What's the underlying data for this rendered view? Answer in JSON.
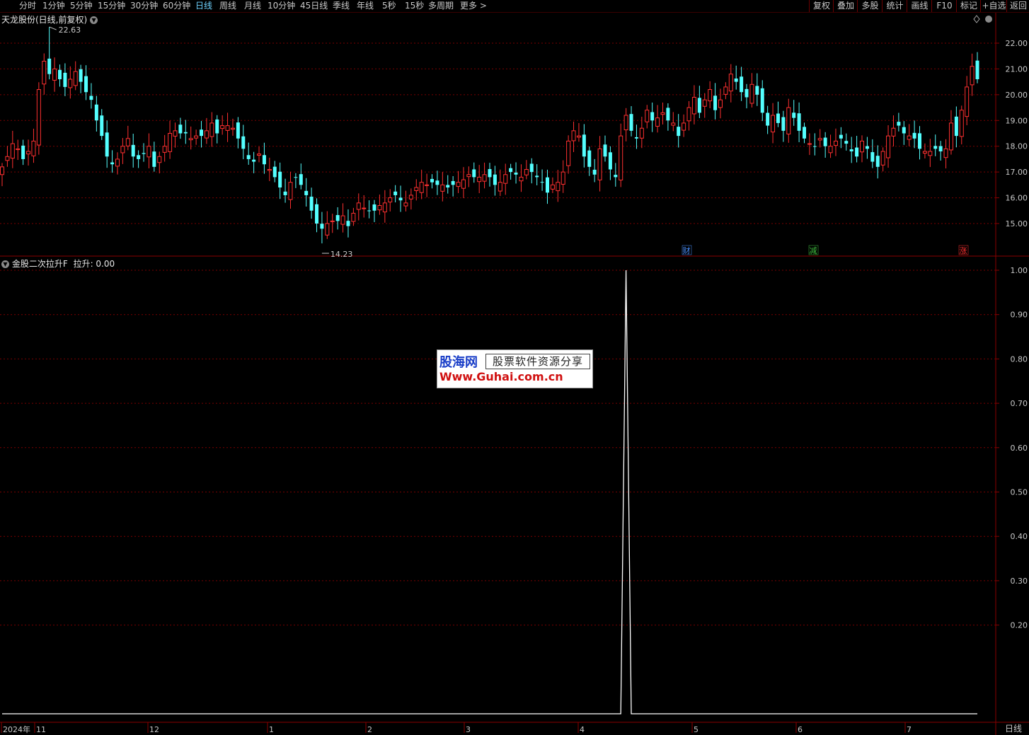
{
  "toolbar": {
    "tabs": [
      "分时",
      "1分钟",
      "5分钟",
      "15分钟",
      "30分钟",
      "60分钟",
      "日线",
      "周线",
      "月线",
      "10分钟",
      "45日线",
      "季线",
      "年线",
      "5秒",
      "15秒",
      "多周期",
      "更多 >"
    ],
    "active_tab": "日线",
    "right_buttons": [
      "复权",
      "叠加",
      "多股",
      "统计",
      "画线",
      "F10",
      "标记",
      "+自选",
      "返回"
    ]
  },
  "upper_panel": {
    "title": "天龙股份(日线,前复权)",
    "high_marker": "22.63",
    "low_marker": "14.23",
    "price_ticks": [
      "22.00",
      "21.00",
      "20.00",
      "19.00",
      "18.00",
      "17.00",
      "16.00",
      "15.00"
    ],
    "event_markers": [
      {
        "label": "财",
        "color": "#4a90ff"
      },
      {
        "label": "减",
        "color": "#40c040"
      },
      {
        "label": "涨",
        "color": "#ff3030"
      }
    ],
    "icons": [
      "diamond-icon",
      "collapse-icon"
    ]
  },
  "lower_panel": {
    "title": "金股二次拉升F",
    "indicator_label": "拉升: 0.00",
    "value_ticks": [
      "1.00",
      "0.90",
      "0.80",
      "0.70",
      "0.60",
      "0.50",
      "0.40",
      "0.30",
      "0.20"
    ]
  },
  "date_axis": {
    "labels": [
      "2024年",
      "11",
      "12",
      "1",
      "2",
      "3",
      "4",
      "5",
      "6",
      "7"
    ]
  },
  "bottom_right_label": "日线",
  "watermark": {
    "brand": "股海网",
    "tagline": "股票软件资源分享",
    "url": "Www.Guhai.com.cn"
  },
  "colors": {
    "up": "#ff3030",
    "down": "#54ffff",
    "grid": "#7a0000",
    "active_tab": "#6fd3ff",
    "indicator_line": "#ffffff"
  },
  "chart_data": [
    {
      "type": "candlestick",
      "title": "天龙股份(日线,前复权)",
      "ylim": [
        14.0,
        22.9
      ],
      "y_ticks": [
        15,
        16,
        17,
        18,
        19,
        20,
        21,
        22
      ],
      "max_label": 22.63,
      "min_label": 14.23,
      "closes": [
        17.2,
        17.6,
        18.1,
        17.9,
        17.5,
        17.8,
        18.2,
        20.2,
        21.3,
        20.8,
        21.0,
        20.6,
        20.3,
        20.6,
        20.9,
        20.5,
        20.1,
        19.8,
        19.0,
        18.4,
        17.6,
        17.3,
        17.5,
        18.0,
        18.3,
        17.6,
        17.5,
        17.7,
        18.0,
        17.2,
        17.6,
        18.0,
        18.5,
        18.6,
        18.5,
        18.5,
        18.3,
        18.4,
        18.4,
        18.6,
        18.9,
        18.5,
        18.8,
        18.8,
        18.7,
        18.3,
        17.9,
        17.5,
        17.4,
        17.7,
        17.3,
        17.1,
        16.8,
        16.4,
        16.1,
        16.6,
        16.8,
        16.5,
        16.1,
        15.5,
        15.0,
        14.8,
        15.0,
        15.1,
        15.1,
        15.3,
        14.9,
        15.4,
        15.8,
        15.6,
        15.5,
        15.5,
        15.7,
        15.8,
        16.0,
        16.1,
        15.9,
        15.8,
        16.1,
        16.4,
        16.6,
        16.5,
        16.6,
        16.5,
        16.5,
        16.4,
        16.5,
        16.6,
        16.7,
        16.9,
        16.8,
        16.8,
        16.9,
        16.8,
        16.5,
        16.6,
        16.9,
        17.0,
        16.9,
        16.8,
        17.1,
        17.0,
        16.8,
        16.6,
        16.2,
        16.5,
        16.6,
        17.0,
        18.2,
        18.6,
        18.4,
        17.6,
        17.2,
        16.9,
        17.9,
        17.6,
        17.1,
        16.8,
        18.4,
        19.2,
        18.6,
        18.3,
        18.7,
        19.4,
        19.0,
        19.1,
        19.3,
        19.0,
        18.9,
        18.4,
        18.9,
        19.5,
        19.9,
        19.3,
        19.8,
        20.2,
        19.4,
        19.8,
        20.3,
        20.8,
        20.5,
        20.1,
        19.9,
        20.4,
        20.0,
        19.3,
        18.8,
        19.2,
        18.9,
        18.6,
        19.5,
        19.1,
        18.6,
        18.3,
        18.1,
        18.0,
        18.3,
        18.0,
        18.0,
        18.2,
        18.3,
        18.1,
        17.8,
        17.6,
        18.2,
        17.9,
        17.4,
        17.2,
        17.8,
        18.4,
        18.7,
        18.8,
        18.5,
        18.4,
        18.3,
        17.9,
        17.8,
        17.8,
        17.9,
        17.8,
        17.9,
        18.9,
        18.4,
        19.4,
        20.3,
        21.1,
        20.6
      ]
    },
    {
      "type": "line",
      "series_name": "拉升",
      "ylim": [
        0.0,
        1.0
      ],
      "y_ticks": [
        0.2,
        0.3,
        0.4,
        0.5,
        0.6,
        0.7,
        0.8,
        0.9,
        1.0
      ],
      "values_nonzero": [
        {
          "bar_index": 119,
          "value": 1.0
        }
      ],
      "default_value": 0.0
    }
  ]
}
